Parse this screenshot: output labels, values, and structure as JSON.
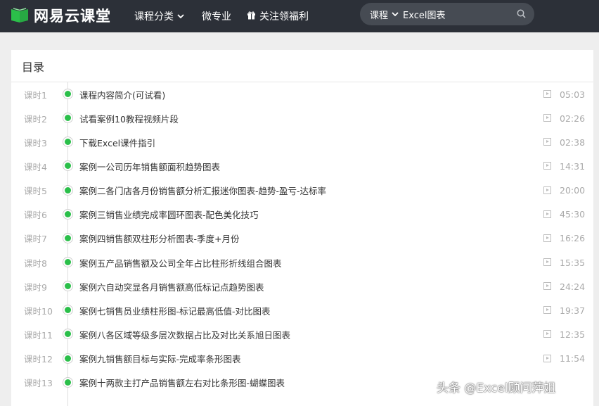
{
  "header": {
    "logo_text": "网易云课堂",
    "nav": {
      "category_label": "课程分类",
      "micro_major_label": "微专业",
      "welfare_label": "关注领福利"
    },
    "search": {
      "type_label": "课程",
      "query": "Excel图表"
    }
  },
  "catalog": {
    "title": "目录",
    "lessons": [
      {
        "index": "课时1",
        "title": "课程内容简介(可试看)",
        "duration": "05:03"
      },
      {
        "index": "课时2",
        "title": "试看案例10教程视频片段",
        "duration": "02:26"
      },
      {
        "index": "课时3",
        "title": "下载Excel课件指引",
        "duration": "02:38"
      },
      {
        "index": "课时4",
        "title": "案例一公司历年销售额面积趋势图表",
        "duration": "14:31"
      },
      {
        "index": "课时5",
        "title": "案例二各门店各月份销售额分析汇报迷你图表-趋势-盈亏-达标率",
        "duration": "20:00"
      },
      {
        "index": "课时6",
        "title": "案例三销售业绩完成率圆环图表-配色美化技巧",
        "duration": "45:30"
      },
      {
        "index": "课时7",
        "title": "案例四销售额双柱形分析图表-季度+月份",
        "duration": "16:26"
      },
      {
        "index": "课时8",
        "title": "案例五产品销售额及公司全年占比柱形折线组合图表",
        "duration": "15:35"
      },
      {
        "index": "课时9",
        "title": "案例六自动突显各月销售额高低标记点趋势图表",
        "duration": "24:24"
      },
      {
        "index": "课时10",
        "title": "案例七销售员业绩柱形图-标记最高低值-对比图表",
        "duration": "19:37"
      },
      {
        "index": "课时11",
        "title": "案例八各区域等级多层次数据占比及对比关系旭日图表",
        "duration": "12:35"
      },
      {
        "index": "课时12",
        "title": "案例九销售额目标与实际-完成率条形图表",
        "duration": "11:54"
      },
      {
        "index": "课时13",
        "title": "案例十两款主打产品销售额左右对比条形图-蝴蝶图表",
        "duration": ""
      }
    ]
  },
  "watermark": "头条 @Excel顾问萍姐",
  "colors": {
    "topbar": "#2c3038",
    "search_bg": "#464b53",
    "dot": "#2bbf4a",
    "logo_green": "#2bbf4a"
  }
}
